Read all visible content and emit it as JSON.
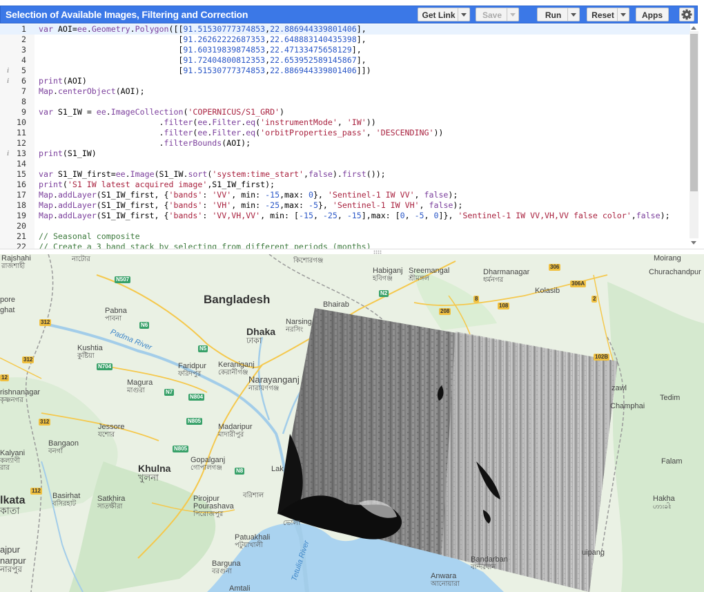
{
  "header": {
    "title": "Selection of Available Images, Filtering and Correction",
    "buttons": {
      "get_link": "Get Link",
      "save": "Save",
      "run": "Run",
      "reset": "Reset",
      "apps": "Apps"
    }
  },
  "editor": {
    "lines": [
      {
        "n": "1",
        "info": "",
        "code": "var AOI=ee.Geometry.Polygon([[91.51530777374853,22.886944339801406],"
      },
      {
        "n": "2",
        "info": "",
        "code": "                             [91.26262222687353,22.648883140435398],"
      },
      {
        "n": "3",
        "info": "",
        "code": "                             [91.60319839874853,22.47133475658129],"
      },
      {
        "n": "4",
        "info": "",
        "code": "                             [91.72404800812353,22.653952589145867],"
      },
      {
        "n": "5",
        "info": "i",
        "code": "                             [91.51530777374853,22.886944339801406]])"
      },
      {
        "n": "6",
        "info": "i",
        "code": "print(AOI)"
      },
      {
        "n": "7",
        "info": "",
        "code": "Map.centerObject(AOI);"
      },
      {
        "n": "8",
        "info": "",
        "code": ""
      },
      {
        "n": "9",
        "info": "",
        "code": "var S1_IW = ee.ImageCollection('COPERNICUS/S1_GRD')"
      },
      {
        "n": "10",
        "info": "",
        "code": "                         .filter(ee.Filter.eq('instrumentMode', 'IW'))"
      },
      {
        "n": "11",
        "info": "",
        "code": "                         .filter(ee.Filter.eq('orbitProperties_pass', 'DESCENDING'))"
      },
      {
        "n": "12",
        "info": "",
        "code": "                         .filterBounds(AOI);"
      },
      {
        "n": "13",
        "info": "i",
        "code": "print(S1_IW)"
      },
      {
        "n": "14",
        "info": "",
        "code": ""
      },
      {
        "n": "15",
        "info": "",
        "code": "var S1_IW_first=ee.Image(S1_IW.sort('system:time_start',false).first());"
      },
      {
        "n": "16",
        "info": "",
        "code": "print('S1 IW latest acquired image',S1_IW_first);"
      },
      {
        "n": "17",
        "info": "",
        "code": "Map.addLayer(S1_IW_first, {'bands': 'VV', min: -15,max: 0}, 'Sentinel-1 IW VV', false);"
      },
      {
        "n": "18",
        "info": "",
        "code": "Map.addLayer(S1_IW_first, {'bands': 'VH', min: -25,max: -5}, 'Sentinel-1 IW VH', false);"
      },
      {
        "n": "19",
        "info": "",
        "code": "Map.addLayer(S1_IW_first, {'bands': 'VV,VH,VV', min: [-15, -25, -15],max: [0, -5, 0]}, 'Sentinel-1 IW VV,VH,VV false color',false);"
      },
      {
        "n": "20",
        "info": "",
        "code": ""
      },
      {
        "n": "21",
        "info": "",
        "code": "// Seasonal composite"
      },
      {
        "n": "22",
        "info": "",
        "code": "// Create a 3 band stack by selecting from different periods (months)"
      }
    ]
  },
  "map": {
    "labels": {
      "rajshahi": "Rajshahi",
      "rajshahi_bn": "রাজশাহী",
      "natore_bn": "নাটোর",
      "bangladesh": "Bangladesh",
      "pabna": "Pabna",
      "pabna_bn": "পাবনা",
      "padma": "Padma River",
      "kushtia": "Kushtia",
      "kushtia_bn": "কুষ্টিয়া",
      "dhaka": "Dhaka",
      "dhaka_bn": "ঢাকা",
      "narsingdi": "Narsing",
      "narsingdi_bn": "নরসিং",
      "bhairab": "Bhairab",
      "habiganj": "Habiganj",
      "habiganj_bn": "হবিগঞ্জ",
      "kishoreganj_bn": "কিশোরগঞ্জ",
      "sreemangal": "Sreemangal",
      "sreemangal_bn": "শ্রীমঙ্গল",
      "dharmanagar": "Dharmanagar",
      "dharmanagar_bn": "ধর্মনগর",
      "kolasib": "Kolasib",
      "moirang": "Moirang",
      "churachandpur": "Churachandpur",
      "faridpur": "Faridpur",
      "faridpur_bn": "ফরিদপুর",
      "keraniganj": "Keraniganj",
      "keraniganj_bn": "কেরানীগঞ্জ",
      "narayanganj": "Narayanganj",
      "narayanganj_bn": "নারায়ণগঞ্জ",
      "magura": "Magura",
      "magura_bn": "মাগুরা",
      "krishnanagar": "rishnanagar",
      "krishnanagar_bn": "কৃষ্ণনগর",
      "jessore": "Jessore",
      "jessore_bn": "যশোর",
      "madaripur": "Madaripur",
      "madaripur_bn": "মাদারীপুর",
      "bangaon": "Bangaon",
      "bangaon_bn": "বনগাঁ",
      "kalyani": "Kalyani",
      "kalyani_bn": "কল্যাণী",
      "khulna": "Khulna",
      "khulna_bn": "খুলনা",
      "gopalganj": "Gopalganj",
      "gopalganj_bn": "গোপালগঞ্জ",
      "lak": "Lak",
      "kolkata": "lkata",
      "kolkata_bn": "কাতা",
      "basirhat": "Basirhat",
      "basirhat_bn": "বসিরহাট",
      "satkhira": "Satkhira",
      "satkhira_bn": "সাতক্ষীরা",
      "pirojpur": "Pirojpur",
      "pourashava": "Pourashava",
      "pirojpur_bn": "পিরোজপুর",
      "barishal_bn": "বরিশাল",
      "bhola_bn": "ভোলা",
      "rajpur": "ajpur",
      "sonarpur": "narpur",
      "sonarpur_bn": "নারপুর",
      "patuakhali": "Patuakhali",
      "patuakhali_bn": "পটুয়াখালী",
      "tetulia": "Tetulia River",
      "barguna": "Barguna",
      "barguna_bn": "বরগুনা",
      "amtali": "Amtali",
      "anwara": "Anwara",
      "anwara_bn": "আনোয়ারা",
      "bandarban": "Bandarban",
      "bandarban_bn": "বান্দরবান",
      "uipang": "uipang",
      "zawl": "zawl",
      "champhai": "Champhai",
      "tedim": "Tedim",
      "falam": "Falam",
      "hakha": "Hakha",
      "hakha_bn": "ဟားခါး",
      "pore": "pore",
      "ghat": "ghat",
      "nabadwip_bn": "রার"
    },
    "shields": {
      "n507": "N507",
      "n2": "N2",
      "n6": "N6",
      "n5": "N5",
      "n704": "N704",
      "n7": "N7",
      "n804": "N804",
      "n805": "N805",
      "n8": "N8",
      "r312a": "312",
      "r312b": "312",
      "r312c": "312",
      "r12": "12",
      "r112": "112",
      "r208": "208",
      "r8": "8",
      "r108": "108",
      "r2": "2",
      "r306": "306",
      "r306a": "306A",
      "r102b": "102B"
    },
    "colors": {
      "land": "#eaf1e4",
      "green": "#d3ead0",
      "water": "#aad3f0",
      "road": "#f5c84c"
    }
  }
}
